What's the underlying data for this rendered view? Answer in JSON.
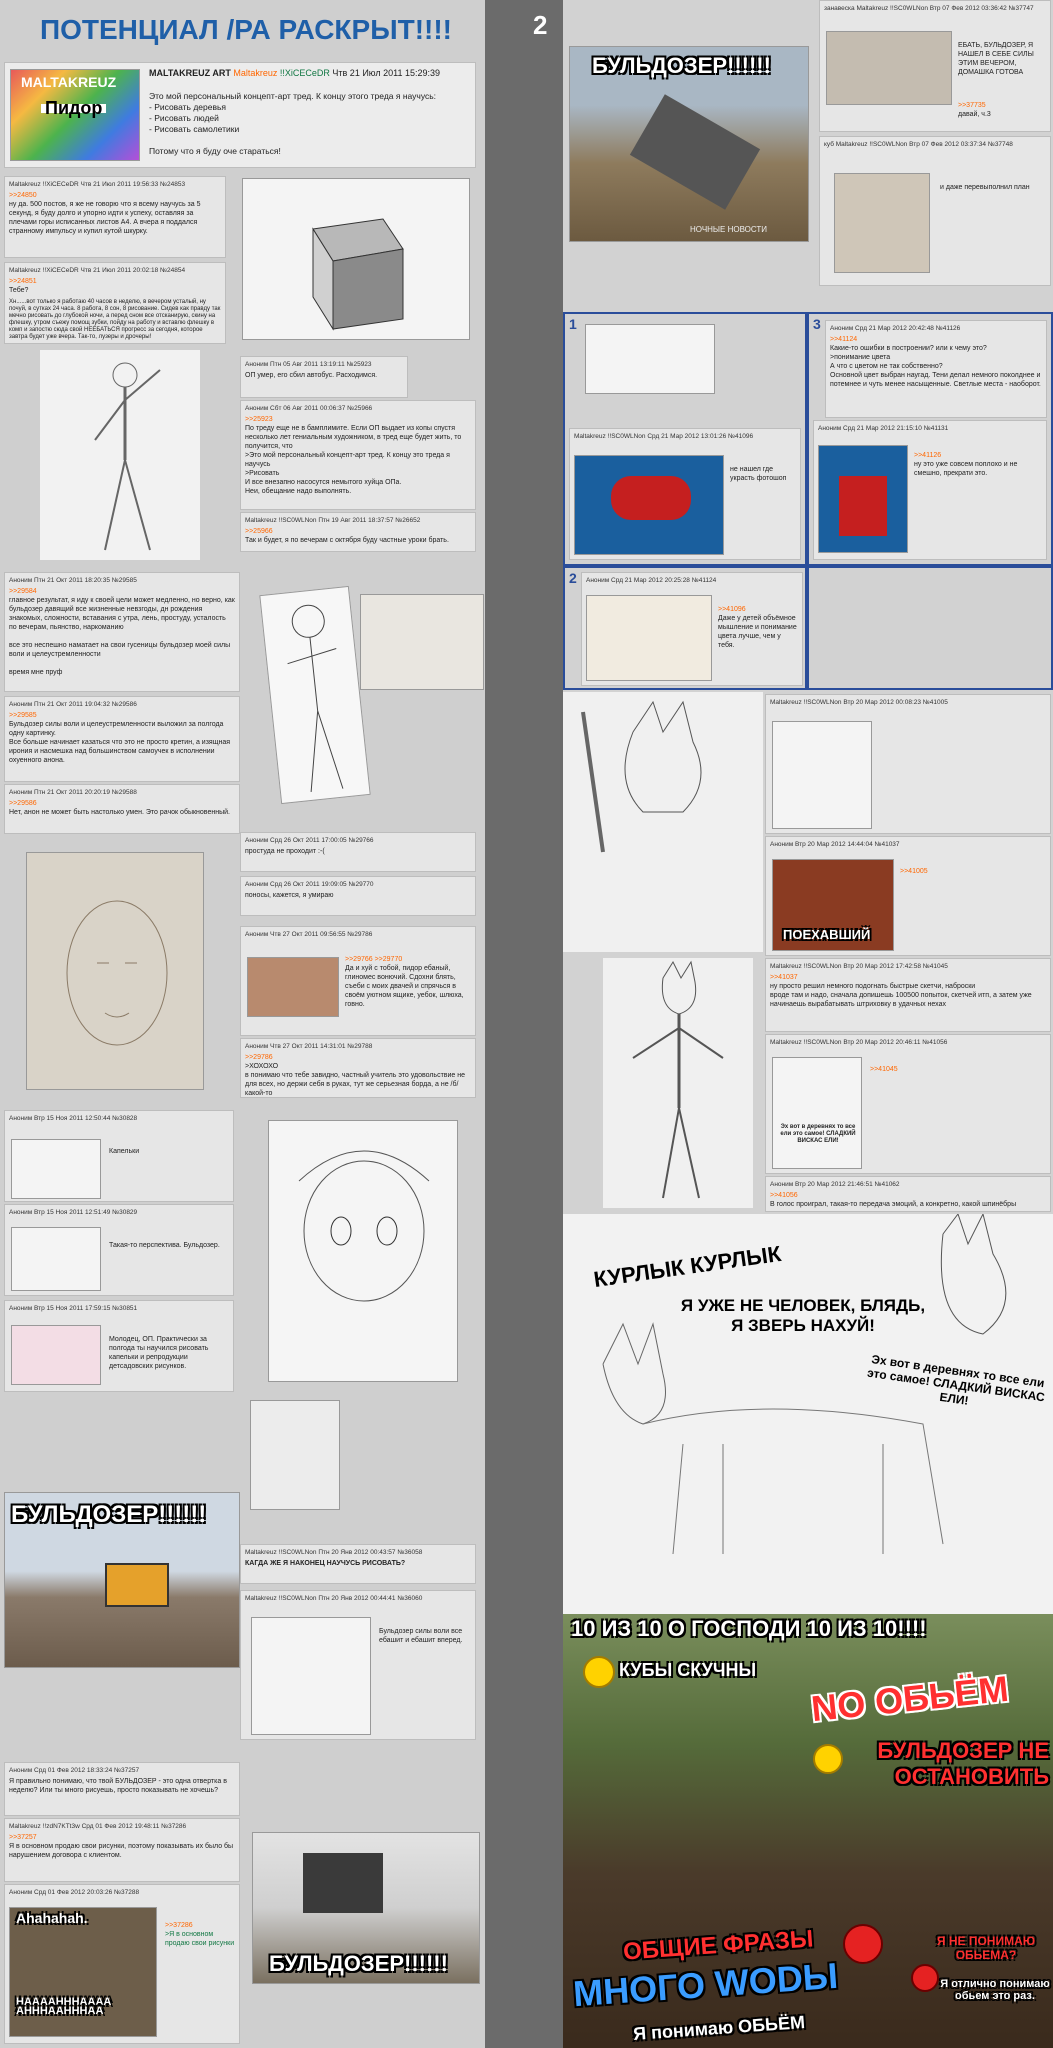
{
  "title": "ПОТЕНЦИАЛ /РА РАСКРЫТ!!!!",
  "page_number": "2",
  "colors": {
    "title": "#1f5fa8",
    "name": "#117743",
    "link": "#ff6600"
  },
  "op": {
    "name": "MALTAKREUZ ART",
    "tripname": "Maltakreuz",
    "trip": "!!XiCECeDR",
    "date": "Чтв 21 Июл 2011 15:29:39",
    "thumb_label": "Пидор",
    "thumb_top": "MALTAKREUZ",
    "body": "Это мой персональный концепт-арт тред. К концу этого треда я научусь:\n- Рисовать деревья\n- Рисовать людей\n- Рисовать самолетики\n\nПотому что я буду оче стараться!"
  },
  "left_posts": [
    {
      "hdr": "Maltakreuz !!XiCECeDR Чтв 21 Июл 2011 19:56:33 №24853",
      "link": ">>24850",
      "body": "ну да. 500 постов, я же не говорю что я всему научусь за 5 секунд, я буду долго и упорно идти к успеху, оставляя за плечами горы исписанных листов А4. А вчера я поддался странному импульсу и купил кутой шкурку."
    },
    {
      "hdr": "Maltakreuz !!XiCECeDR Чтв 21 Июл 2011 20:02:18 №24854",
      "link": ">>24851",
      "body": "Тебе?"
    },
    {
      "hdr": "",
      "link": "",
      "body": "Хн......вот только я работаю 40 часов в неделю, в вечером усталый, ну почуй, в сутках 24 часа. 8 работа, 8 сон, 8 рисование. Сидев как правду так мечно рисовать до глубокой ночи, а перед сном все отсканирую, скину на флешку, утром съежу помощ зубки, пойду на работу и вставлю флешку в комп и запостю сюда свой НЕЕБАТЬСЯ прогресс за сегодня, которое завтра будет уже вчера. Так-то, лузеры и дрочеры!"
    },
    {
      "hdr": "Аноним Птн 05 Авг 2011 13:19:11 №25923",
      "link": "",
      "body": "ОП умер, его сбил автобус. Расходимся."
    },
    {
      "hdr": "Аноним Сбт 06 Авг 2011 00:06:37 №25966",
      "link": ">>25923",
      "body": "По треду еще не в бамплимите. Если ОП выдает из копы спустя несколько лет гениальным художником, в тред еще будет жить, то получится, что\n>Это мой персональный концепт-арт тред. К концу это треда я научусь\n>Рисовать\nИ все внезапно насосутся немытого хуйца ОПа.\nНеи, обещание надо выполнять."
    },
    {
      "hdr": "Maltakreuz !!SC0WLNon Птн 19 Авг 2011 18:37:57 №26652",
      "link": ">>25966",
      "body": "Так и будет, я по вечерам с октября буду частные уроки брать."
    },
    {
      "hdr": "Аноним Птн 21 Окт 2011 18:20:35 №29585",
      "link": ">>29584",
      "body": "главное результат, я иду к своей цели может медленно, но верно, как бульдозер давящий все жизненные невзгоды, дн рождения знакомых, сложности, вставания с утра, лень, простуду, усталость по вечерам, пьянство, наркоманию\n\nвсе это неспешно наматает на свои гусеницы бульдозер моей силы воли и целеустремленности\n\nвремя мне пруф"
    },
    {
      "hdr": "Аноним Птн 21 Окт 2011 19:04:32 №29586",
      "link": ">>29585",
      "body": "Бульдозер силы воли и целеустремленности выложил за полгода одну картинку.\nВсе больше начинает казаться что это не просто кретин, а изящная ирония и насмешка над большинством самоучек в исполнении охуенного анона."
    },
    {
      "hdr": "Аноним Птн 21 Окт 2011 20:20:19 №29588",
      "link": ">>29586",
      "body": "Нет, анон не может быть настолько умен. Это рачок обыкновенный."
    },
    {
      "hdr": "Аноним Срд 26 Окт 2011 17:00:05 №29766",
      "link": "",
      "body": "простуда не проходит :-("
    },
    {
      "hdr": "Аноним Срд 26 Окт 2011 19:09:05 №29770",
      "link": "",
      "body": "поносы, кажется, я умираю"
    },
    {
      "hdr": "Аноним Чтв 27 Окт 2011 09:56:55 №29786",
      "link": ">>29766 >>29770",
      "body": "Да и хуй с тобой, пидор ебаный, глиномес вонючий. Сдохни блять, съеби с моих двачей и спрячься в своём уютном ящике, уебок, шлюха, говно."
    },
    {
      "hdr": "Аноним Чтв 27 Окт 2011 14:31:01 №29788",
      "link": ">>29786",
      "body": ">ХОХОХО\nв понимаю что тебе завидно, частный учитель это удовольствие не для всех, но держи себя в руках, тут же серьезная борда, а не /б/ какой-то"
    },
    {
      "hdr": "Аноним Втр 15 Ноя 2011 12:50:44 №30828",
      "link": "",
      "body": "Капельки"
    },
    {
      "hdr": "Аноним Втр 15 Ноя 2011 12:51:49 №30829",
      "link": "",
      "body": "Такая-то перспектива. Бульдозер."
    },
    {
      "hdr": "Аноним Втр 15 Ноя 2011 17:59:15 №30851",
      "link": "",
      "body": "Молодец, ОП. Практически за полгода ты научился рисовать капельки и репродукции детсадовских рисунков."
    },
    {
      "hdr": "Maltakreuz !!SC0WLNon Птн 20 Янв 2012 00:43:57 №36058",
      "link": "",
      "body": "КАГДА ЖЕ Я НАКОНЕЦ НАУЧУСЬ РИСОВАТЬ?"
    },
    {
      "hdr": "Maltakreuz !!SC0WLNon Птн 20 Янв 2012 00:44:41 №36060",
      "link": "",
      "body": "Бульдозер силы воли все ебашит и ебашит вперед."
    },
    {
      "hdr": "Аноним Срд 01 Фев 2012 18:33:24 №37257",
      "link": "",
      "body": "Я правильно понимаю, что твой БУЛЬДОЗЕР - это одна отвертка в неделю? Или ты много рисуешь, просто показывать не хочешь?"
    },
    {
      "hdr": "Maltakreuz !!zdN7KTt3w Срд 01 Фев 2012 19:48:11 №37286",
      "link": ">>37257",
      "body": "Я в основном продаю свои рисунки, поэтому показывать их было бы нарушением договора с клиентом."
    },
    {
      "hdr": "Аноним Срд 01 Фев 2012 20:03:26 №37288",
      "link": ">>37286",
      "body": ">Я в основном продаю свои рисунки"
    }
  ],
  "left_captions": {
    "bulldozer1": "БУЛЬДОЗЕР!!!!!!",
    "bulldozer2": "БУЛЬДОЗЕР!!!!!!",
    "cat_top": "Ahahahah.",
    "cat_bottom": "HAAAAHHHAAAA AHHHAAHHHAA",
    "watermark": "НОЧНЫЕ НОВОСТИ"
  },
  "right_posts": [
    {
      "hdr": "занавеска Maltakreuz !!SC0WLNon Втр 07 Фев 2012 03:36:42 №37747",
      "link": "",
      "body": "ЕБАТЬ, БУЛЬДОЗЕР, Я НАШЕЛ В СЕБЕ СИЛЫ ЭТИМ ВЕЧЕРОМ, ДОМАШКА ГОТОВА"
    },
    {
      "hdr": "",
      "link": ">>37735",
      "body": "давай, ч.3"
    },
    {
      "hdr": "куб Maltakreuz !!SC0WLNon Втр 07 Фев 2012 03:37:34 №37748",
      "link": "",
      "body": "и даже перевыполнил план"
    },
    {
      "hdr": "Maltakreuz !!SC0WLNon Срд 21 Мар 2012 13:01:26 №41096",
      "link": "",
      "body": "не нашел где украсть фотошоп"
    },
    {
      "hdr": "Аноним Срд 21 Мар 2012 20:42:48 №41126",
      "link": ">>41124",
      "body": "Какие-то ошибки в построении? или к чему это?\n>понимание цвета\nА что с цветом не так собственно?\nОсновной цвет выбран наугад. Тени делал немного поколднее и потемнее и чуть менее насыщенные. Светлые места - наоборот."
    },
    {
      "hdr": "Аноним Срд 21 Мар 2012 21:15:10 №41131",
      "link": ">>41126",
      "body": "ну это уже совсем поплохо и не смешно, прекрати это."
    },
    {
      "hdr": "Аноним Срд 21 Мар 2012 20:25:28 №41124",
      "link": ">>41096",
      "body": "Даже у детей объёмное мышление и понимание цвета лучше, чем у тебя."
    },
    {
      "hdr": "Maltakreuz !!SC0WLNon Втр 20 Мар 2012 00:08:23 №41005",
      "link": "",
      "body": ""
    },
    {
      "hdr": "Аноним Втр 20 Мар 2012 14:44:04 №41037",
      "link": ">>41005",
      "body": ""
    },
    {
      "hdr": "Maltakreuz !!SC0WLNon Втр 20 Мар 2012 17:42:58 №41045",
      "link": ">>41037",
      "body": "ну просто решил немного подогнать быстрые скетчи, наброски\nвроде там и надо, сначала допишешь 100500 попыток, скетчей итп, а затем уже начинаешь вырабатывать штриховку в удачных нехах"
    },
    {
      "hdr": "Maltakreuz !!SC0WLNon Втр 20 Мар 2012 20:46:11 №41056",
      "link": ">>41045",
      "body": ""
    },
    {
      "hdr": "Аноним Втр 20 Мар 2012 21:46:51 №41062",
      "link": ">>41056",
      "body": "В голос проиграл, такая-то передача эмоций, а конкретно, какой шпинёбры"
    }
  ],
  "right_captions": {
    "bulldozer": "БУЛЬДОЗЕР!!!!!!",
    "poekhavshiy": "ПОЕХАВШИЙ",
    "sweet_caption": "Эх вот в деревнях то все ели это самое! СЛАДКИЙ ВИСКАС ЕЛИ!",
    "kurlyk": "КУРЛЫК КУРЛЫК",
    "not_human": "Я УЖЕ НЕ ЧЕЛОВЕК, БЛЯДЬ, Я ЗВЕРЬ НАХУЙ!",
    "sweet_big": "Эх вот в деревнях то все ели это самое! СЛАДКИЙ ВИСКАС ЕЛИ!",
    "ten": "10 ИЗ 10 О ГОСПОДИ 10 ИЗ 10!!!!",
    "cubes": "КУБЫ СКУЧНЫ",
    "no_volume": "NO ОБЬЁМ",
    "bulldozer_stop": "БУЛЬДОЗЕР НЕ ОСТАНОВИТЬ",
    "phrases": "ОБЩИЕ ФРАЗЫ",
    "water": "МНОГО WODЫ",
    "understand": "Я понимаю ОБЬЁМ",
    "dont_understand": "Я НЕ ПОНИМАЮ ОБЬЕМА?",
    "perfect": "Я отлично понимаю обьем это раз."
  },
  "box_numbers": [
    "1",
    "2",
    "3"
  ]
}
